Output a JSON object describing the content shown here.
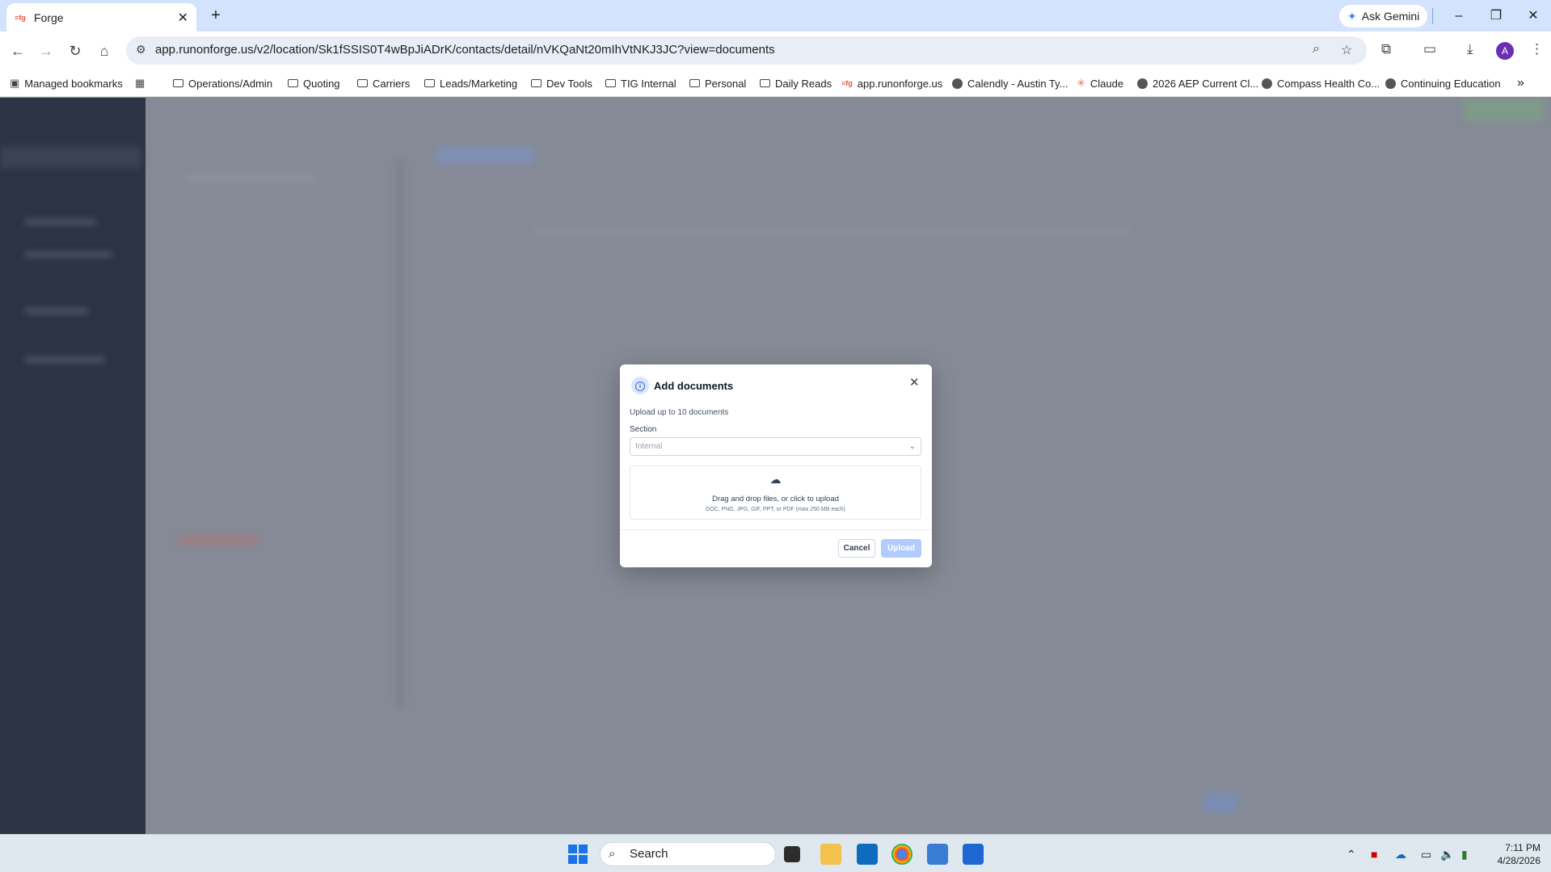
{
  "browser": {
    "tab_title": "Forge",
    "tab_favicon": "forge",
    "new_tab": "+",
    "gemini_label": "Ask Gemini",
    "url": "app.runonforge.us/v2/location/Sk1fSSIS0T4wBpJiADrK/contacts/detail/nVKQaNt20mIhVtNKJ3JC?view=documents",
    "profile_initial": "A"
  },
  "bookmarks": [
    {
      "label": "Managed bookmarks",
      "icon": "managed-icon"
    },
    {
      "label": "Operations/Admin",
      "icon": "folder-icon"
    },
    {
      "label": "Quoting",
      "icon": "folder-icon"
    },
    {
      "label": "Carriers",
      "icon": "folder-icon"
    },
    {
      "label": "Leads/Marketing",
      "icon": "folder-icon"
    },
    {
      "label": "Dev Tools",
      "icon": "folder-icon"
    },
    {
      "label": "TIG Internal",
      "icon": "folder-icon"
    },
    {
      "label": "Personal",
      "icon": "folder-icon"
    },
    {
      "label": "Daily Reads",
      "icon": "folder-icon"
    },
    {
      "label": "app.runonforge.us",
      "icon": "forge-icon"
    },
    {
      "label": "Calendly - Austin Ty...",
      "icon": "globe-icon"
    },
    {
      "label": "Claude",
      "icon": "claude-icon"
    },
    {
      "label": "2026 AEP Current Cl...",
      "icon": "globe-icon"
    },
    {
      "label": "Compass Health Co...",
      "icon": "globe-icon"
    },
    {
      "label": "Continuing Education",
      "icon": "globe-icon"
    }
  ],
  "modal": {
    "title": "Add documents",
    "subtitle": "Upload up to 10 documents",
    "section_label": "Section",
    "section_value": "Internal",
    "drop_text": "Drag and drop files, or click to upload",
    "drop_hint": "DOC, PNG, JPG, GIF, PPT, or PDF (max 250 MB each)",
    "cancel_label": "Cancel",
    "upload_label": "Upload"
  },
  "taskbar": {
    "search_placeholder": "Search",
    "time": "7:11 PM",
    "date": "4/28/2026"
  },
  "colors": {
    "accent": "#2f6fe0",
    "upload_disabled": "#b2ccff",
    "overlay": "#858a96"
  }
}
